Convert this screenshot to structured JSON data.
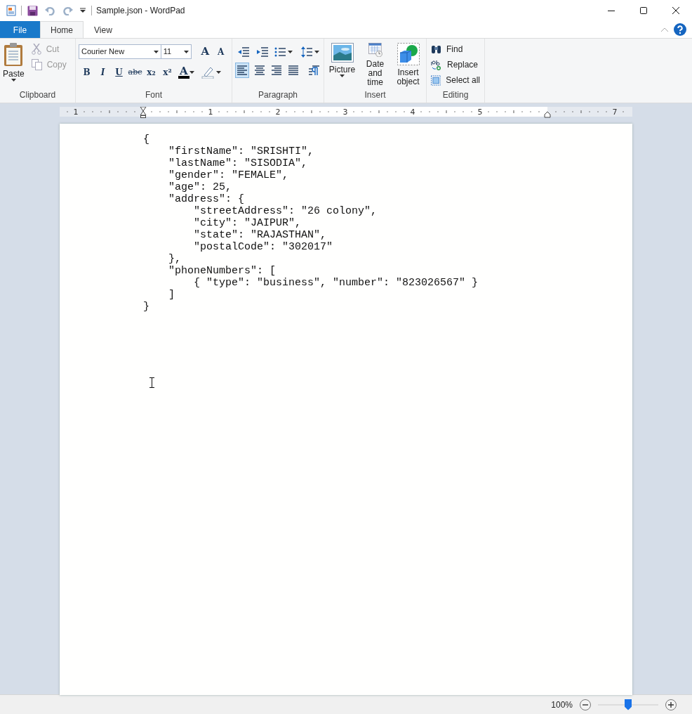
{
  "window": {
    "title": "Sample.json - WordPad"
  },
  "tabs": [
    {
      "label": "File",
      "kind": "file",
      "selected": false
    },
    {
      "label": "Home",
      "kind": "tab",
      "selected": true
    },
    {
      "label": "View",
      "kind": "tab",
      "selected": false
    }
  ],
  "clipboard": {
    "label": "Clipboard",
    "paste": "Paste",
    "cut": {
      "label": "Cut",
      "disabled": true
    },
    "copy": {
      "label": "Copy",
      "disabled": true
    }
  },
  "font": {
    "label": "Font",
    "family": "Courier New",
    "size": "11",
    "grow": "A",
    "shrink": "A",
    "format_buttons": [
      {
        "label": "B",
        "kind": "bold"
      },
      {
        "label": "I",
        "kind": "italic"
      },
      {
        "label": "U",
        "kind": "underline"
      },
      {
        "label": "abc",
        "kind": "strike"
      },
      {
        "label": "x₂",
        "kind": "sub"
      },
      {
        "label": "x²",
        "kind": "sup"
      }
    ],
    "color_label": "A"
  },
  "paragraph": {
    "label": "Paragraph",
    "alignments": [
      {
        "kind": "left",
        "selected": true
      },
      {
        "kind": "center",
        "selected": false
      },
      {
        "kind": "right",
        "selected": false
      },
      {
        "kind": "justify",
        "selected": false
      }
    ]
  },
  "insert": {
    "label": "Insert",
    "buttons": [
      {
        "label": "Picture",
        "kind": "picture"
      },
      {
        "label": "Date and time",
        "kind": "datetime"
      },
      {
        "label": "Insert object",
        "kind": "object"
      }
    ]
  },
  "editing": {
    "label": "Editing",
    "buttons": [
      {
        "label": "Find",
        "kind": "find"
      },
      {
        "label": "Replace",
        "kind": "replace"
      },
      {
        "label": "Select all",
        "kind": "selectall"
      }
    ]
  },
  "ruler": {
    "labels": [
      "1",
      "1",
      "2",
      "3",
      "4",
      "5",
      "7"
    ]
  },
  "document": {
    "lines": [
      "{",
      "    \"firstName\": \"SRISHTI\",",
      "    \"lastName\": \"SISODIA\",",
      "    \"gender\": \"FEMALE\",",
      "    \"age\": 25,",
      "    \"address\": {",
      "        \"streetAddress\": \"26 colony\",",
      "        \"city\": \"JAIPUR\",",
      "        \"state\": \"RAJASTHAN\",",
      "        \"postalCode\": \"302017\"",
      "    },",
      "    \"phoneNumbers\": [",
      "        { \"type\": \"business\", \"number\": \"823026567\" }",
      "    ]",
      "}"
    ]
  },
  "status_bar": {
    "zoom": "100%",
    "level": 0.5
  }
}
